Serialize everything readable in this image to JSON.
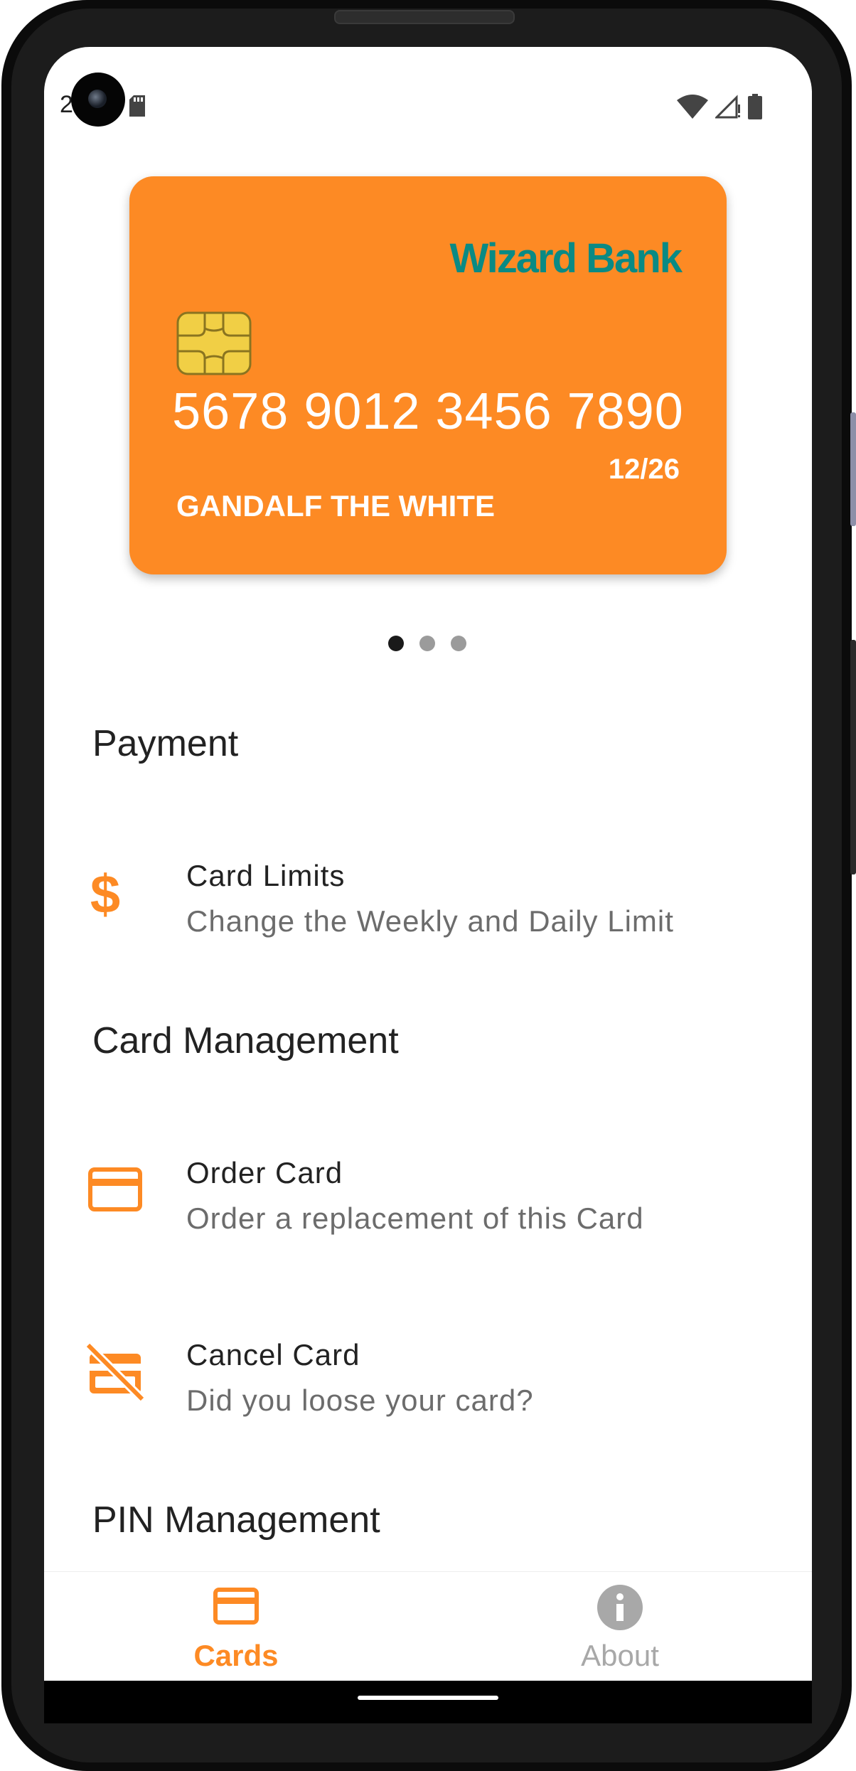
{
  "status_bar": {
    "time": "2"
  },
  "card": {
    "bank_name": "Wizard Bank",
    "number": "5678 9012 3456 7890",
    "expiry": "12/26",
    "holder": "GANDALF THE WHITE",
    "color": "#fd8a24",
    "bank_color": "#0a8a84"
  },
  "carousel": {
    "count": 3,
    "active_index": 0
  },
  "sections": {
    "payment": {
      "title": "Payment",
      "items": [
        {
          "icon": "dollar-icon",
          "title": "Card Limits",
          "subtitle": "Change the Weekly and Daily Limit"
        }
      ]
    },
    "card_management": {
      "title": "Card Management",
      "items": [
        {
          "icon": "credit-card-icon",
          "title": "Order Card",
          "subtitle": "Order a replacement of this Card"
        },
        {
          "icon": "credit-card-off-icon",
          "title": "Cancel Card",
          "subtitle": "Did you loose your card?"
        }
      ]
    },
    "pin_management": {
      "title": "PIN Management"
    }
  },
  "bottom_nav": {
    "items": [
      {
        "icon": "credit-card-icon",
        "label": "Cards",
        "active": true
      },
      {
        "icon": "info-icon",
        "label": "About",
        "active": false
      }
    ]
  },
  "colors": {
    "accent": "#fd8a24",
    "text_primary": "#222222",
    "text_secondary": "#6c6c6c",
    "inactive": "#a8a8a8"
  }
}
